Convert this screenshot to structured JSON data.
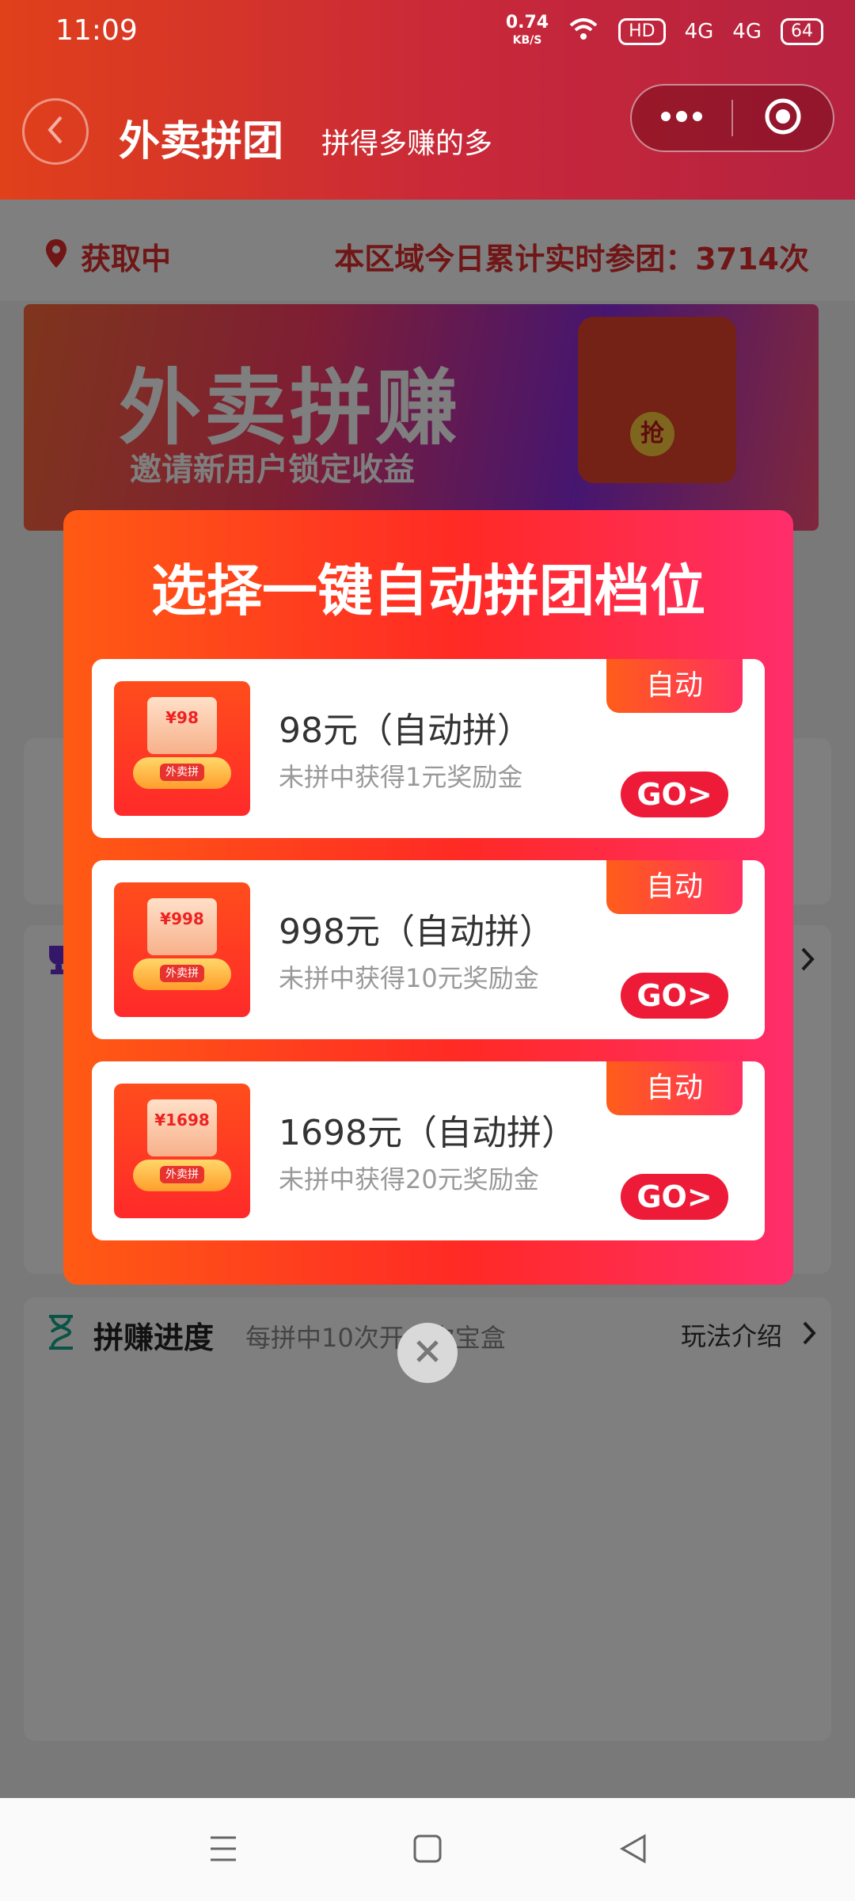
{
  "status_bar": {
    "time": "11:09",
    "net_speed": "0.74",
    "net_unit": "KB/S",
    "hd": "HD",
    "sig1": "4G",
    "sig2": "4G",
    "battery": "64"
  },
  "header": {
    "title": "外卖拼团",
    "subtitle": "拼得多赚的多"
  },
  "location": {
    "label": "获取中",
    "stat": "本区域今日累计实时参团：3714次"
  },
  "banner": {
    "title": "外卖拼赚",
    "subtitle": "邀请新用户锁定收益",
    "badge": "抢"
  },
  "modal": {
    "title": "选择一键自动拼团档位",
    "options": [
      {
        "thumb_price": "¥98",
        "thumb_label": "外卖拼",
        "name": "98元（自动拼）",
        "desc": "未拼中获得1元奖励金",
        "tag": "自动",
        "go": "GO>"
      },
      {
        "thumb_price": "¥998",
        "thumb_label": "外卖拼",
        "name": "998元（自动拼）",
        "desc": "未拼中获得10元奖励金",
        "tag": "自动",
        "go": "GO>"
      },
      {
        "thumb_price": "¥1698",
        "thumb_label": "外卖拼",
        "name": "1698元（自动拼）",
        "desc": "未拼中获得20元奖励金",
        "tag": "自动",
        "go": "GO>"
      }
    ]
  },
  "progress": {
    "title": "拼赚进度",
    "desc": "每拼中10次开一次宝盒",
    "link": "玩法介绍"
  },
  "icons": {
    "location": "location-pin-icon",
    "hourglass": "hourglass-icon",
    "trophy": "trophy-icon",
    "close": "close-icon",
    "back": "back-arrow-icon",
    "more": "more-dots-icon",
    "target": "target-icon"
  },
  "colors": {
    "accent": "#e12c2c",
    "header": "#c8283a",
    "go": "#ee1b38"
  }
}
